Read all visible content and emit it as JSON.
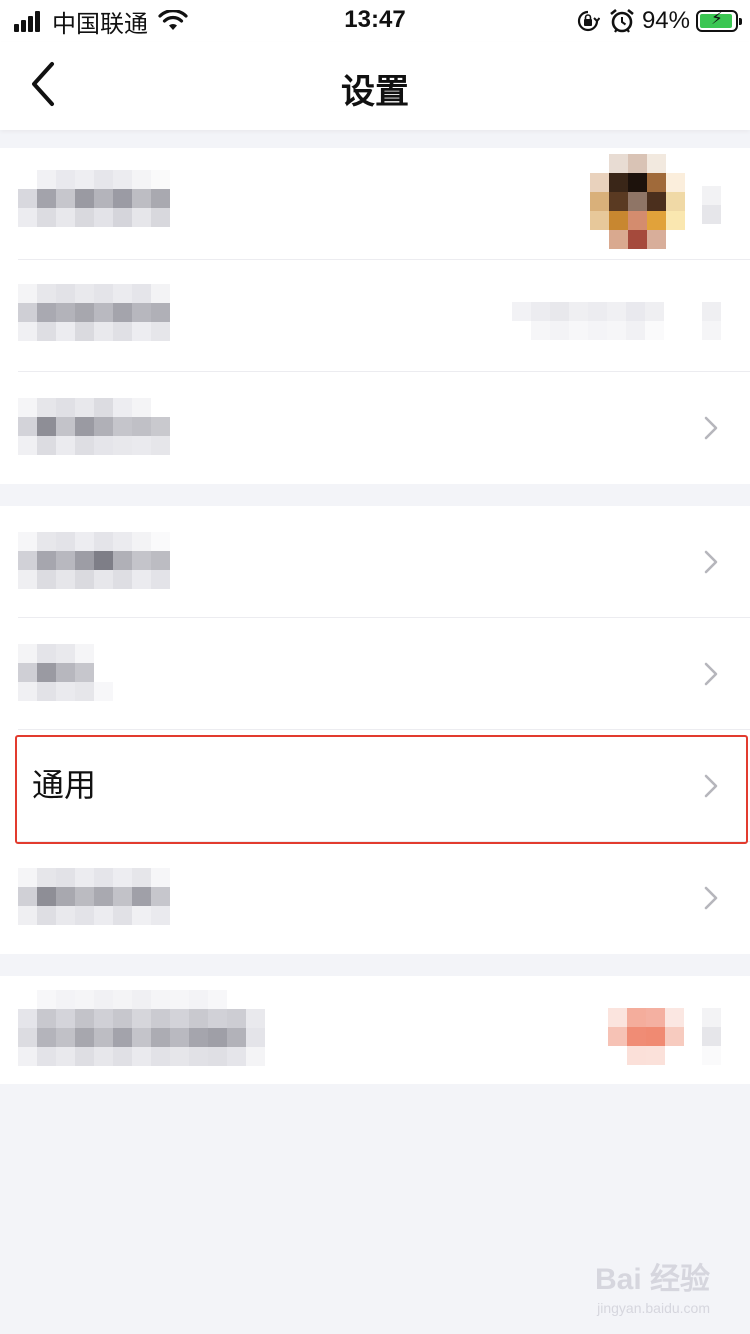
{
  "status_bar": {
    "carrier": "中国联通",
    "time": "13:47",
    "battery_percent": "94%",
    "battery_level": 0.94,
    "icons": [
      "signal-icon",
      "wifi-icon",
      "orientation-lock-icon",
      "alarm-icon",
      "battery-charging-icon"
    ]
  },
  "nav": {
    "title": "设置",
    "back_icon": "chevron-left-icon"
  },
  "rows": {
    "general": {
      "label": "通用"
    }
  },
  "colors": {
    "highlight": "#e23b2e",
    "battery_fill": "#3bc652",
    "page_background": "#f3f4f8"
  },
  "watermark": {
    "brand": "Bai  经验",
    "url": "jingyan.baidu.com"
  }
}
